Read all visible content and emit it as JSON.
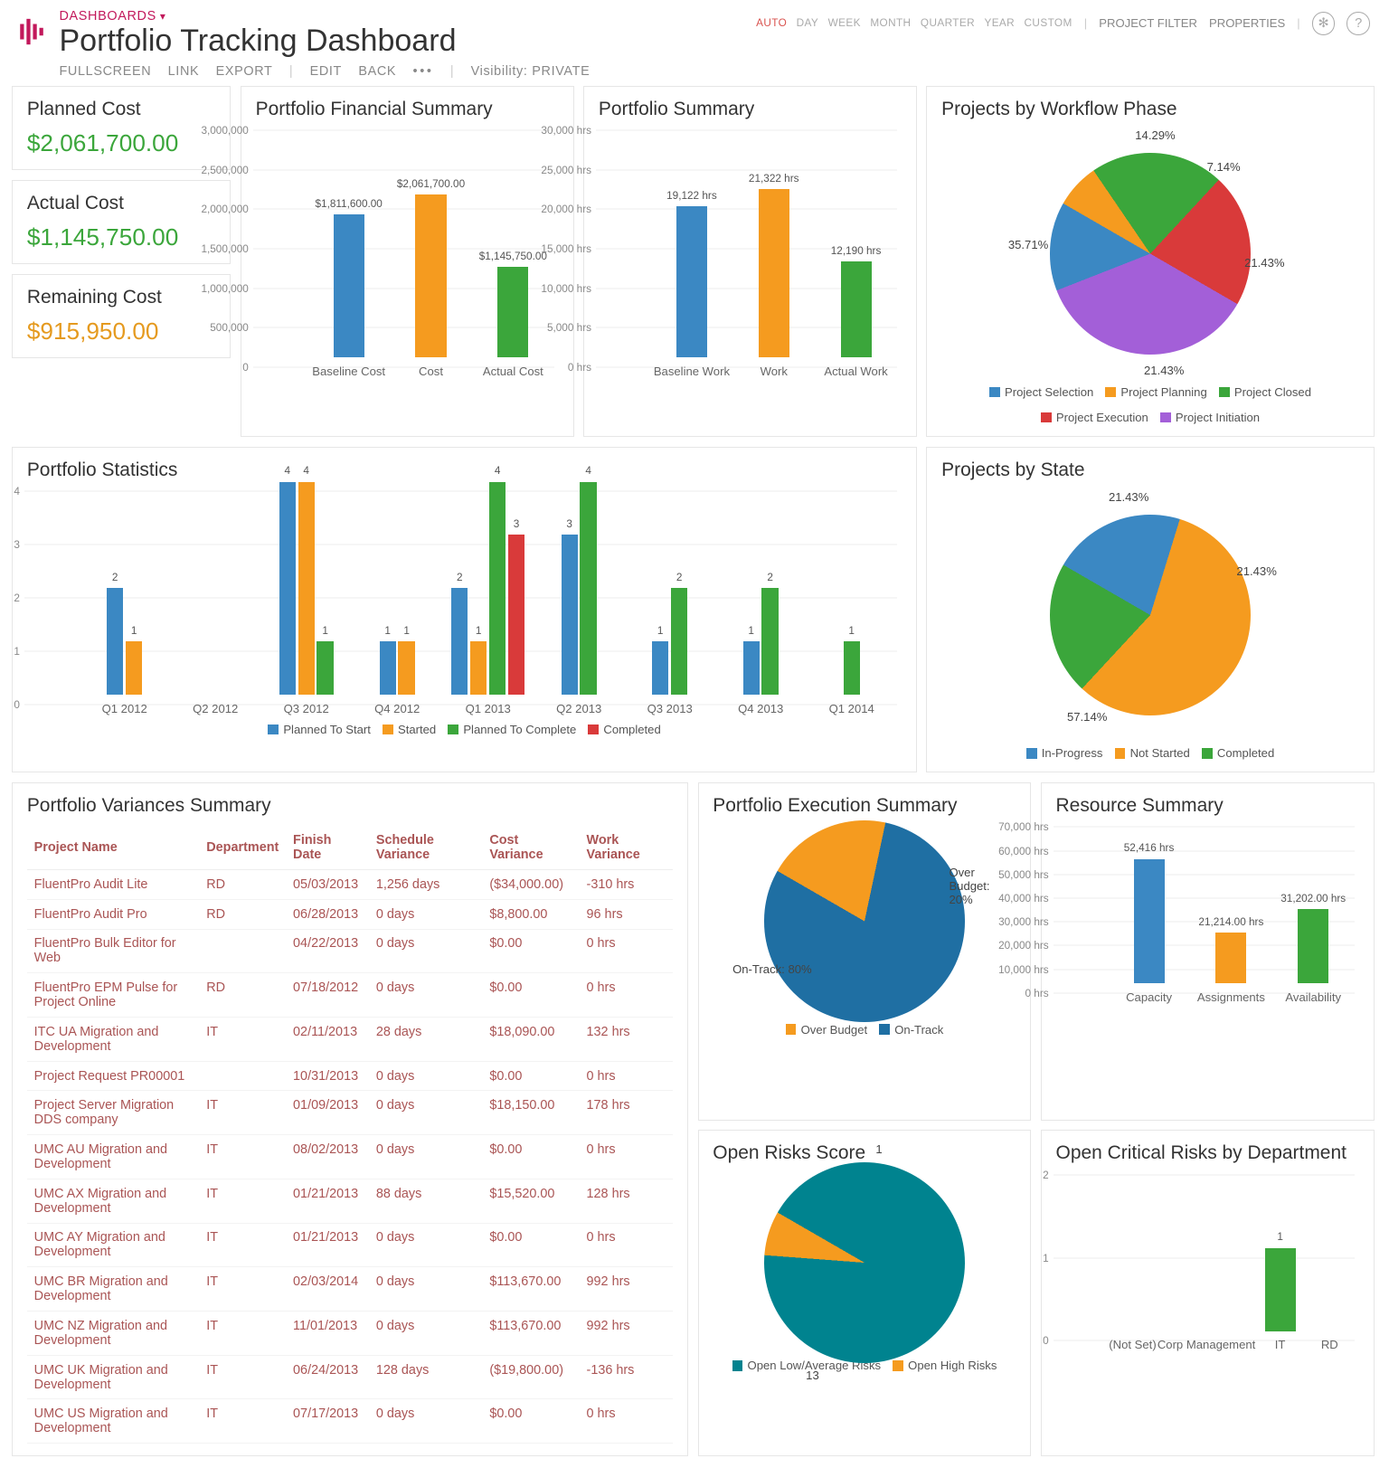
{
  "header": {
    "crumb": "DASHBOARDS",
    "title": "Portfolio Tracking Dashboard",
    "toolbar": {
      "fullscreen": "FULLSCREEN",
      "link": "LINK",
      "export": "EXPORT",
      "edit": "EDIT",
      "back": "BACK",
      "vis_label": "Visibility:",
      "vis_value": "PRIVATE"
    },
    "scope": [
      "AUTO",
      "DAY",
      "WEEK",
      "MONTH",
      "QUARTER",
      "YEAR",
      "CUSTOM"
    ],
    "scope_active": "AUTO",
    "filter": "PROJECT FILTER",
    "props": "PROPERTIES"
  },
  "kpi": {
    "planned": {
      "label": "Planned Cost",
      "value": "$2,061,700.00"
    },
    "actual": {
      "label": "Actual Cost",
      "value": "$1,145,750.00"
    },
    "remaining": {
      "label": "Remaining Cost",
      "value": "$915,950.00"
    }
  },
  "financial": {
    "title": "Portfolio Financial Summary",
    "type": "bar",
    "ylim": [
      0,
      3000000
    ],
    "ticks": [
      0,
      500000,
      1000000,
      1500000,
      2000000,
      2500000,
      3000000
    ],
    "tick_labels": [
      "0",
      "500,000",
      "1,000,000",
      "1,500,000",
      "2,000,000",
      "2,500,000",
      "3,000,000"
    ],
    "categories": [
      "Baseline Cost",
      "Cost",
      "Actual Cost"
    ],
    "values": [
      1811600,
      2061700,
      1145750
    ],
    "data_labels": [
      "$1,811,600.00",
      "$2,061,700.00",
      "$1,145,750.00"
    ],
    "colors": [
      "blue",
      "orange",
      "green"
    ]
  },
  "work": {
    "title": "Portfolio Summary",
    "type": "bar",
    "ylim": [
      0,
      30000
    ],
    "ticks": [
      0,
      5000,
      10000,
      15000,
      20000,
      25000,
      30000
    ],
    "tick_labels": [
      "0 hrs",
      "5,000 hrs",
      "10,000 hrs",
      "15,000 hrs",
      "20,000 hrs",
      "25,000 hrs",
      "30,000 hrs"
    ],
    "categories": [
      "Baseline Work",
      "Work",
      "Actual Work"
    ],
    "values": [
      19122,
      21322,
      12190
    ],
    "data_labels": [
      "19,122 hrs",
      "21,322 hrs",
      "12,190 hrs"
    ],
    "colors": [
      "blue",
      "orange",
      "green"
    ]
  },
  "phase": {
    "title": "Projects by Workflow Phase",
    "type": "pie",
    "legend": [
      "Project Selection",
      "Project Planning",
      "Project Closed",
      "Project Execution",
      "Project Initiation"
    ],
    "colors": [
      "blue",
      "orange",
      "green",
      "red",
      "purple"
    ],
    "slices": [
      {
        "label": "7.14%",
        "v": 7.14,
        "c": "orange"
      },
      {
        "label": "21.43%",
        "v": 21.43,
        "c": "green"
      },
      {
        "label": "21.43%",
        "v": 21.43,
        "c": "red"
      },
      {
        "label": "35.71%",
        "v": 35.71,
        "c": "purple"
      },
      {
        "label": "14.29%",
        "v": 14.29,
        "c": "blue"
      }
    ]
  },
  "stats": {
    "title": "Portfolio Statistics",
    "type": "bar",
    "ylim": [
      0,
      4
    ],
    "ticks": [
      0,
      1,
      2,
      3,
      4
    ],
    "categories": [
      "Q1 2012",
      "Q2 2012",
      "Q3 2012",
      "Q4 2012",
      "Q1 2013",
      "Q2 2013",
      "Q3 2013",
      "Q4 2013",
      "Q1 2014"
    ],
    "series_names": [
      "Planned To Start",
      "Started",
      "Planned To Complete",
      "Completed"
    ],
    "colors": [
      "blue",
      "orange",
      "green",
      "red"
    ],
    "data": [
      {
        "cat": "Q1 2012",
        "v": [
          2,
          1,
          0,
          0
        ]
      },
      {
        "cat": "Q2 2012",
        "v": [
          0,
          0,
          0,
          0
        ]
      },
      {
        "cat": "Q3 2012",
        "v": [
          4,
          4,
          1,
          0
        ]
      },
      {
        "cat": "Q4 2012",
        "v": [
          1,
          1,
          0,
          0
        ]
      },
      {
        "cat": "Q1 2013",
        "v": [
          2,
          1,
          4,
          3
        ]
      },
      {
        "cat": "Q2 2013",
        "v": [
          3,
          0,
          4,
          0
        ]
      },
      {
        "cat": "Q3 2013",
        "v": [
          1,
          0,
          2,
          0
        ]
      },
      {
        "cat": "Q4 2013",
        "v": [
          1,
          0,
          2,
          0
        ]
      },
      {
        "cat": "Q1 2014",
        "v": [
          0,
          0,
          1,
          0
        ]
      }
    ]
  },
  "state": {
    "title": "Projects by State",
    "type": "pie",
    "legend": [
      "In-Progress",
      "Not Started",
      "Completed"
    ],
    "colors": [
      "blue",
      "orange",
      "green"
    ],
    "slices": [
      {
        "label": "21.43%",
        "v": 21.43,
        "c": "blue"
      },
      {
        "label": "57.14%",
        "v": 57.14,
        "c": "orange"
      },
      {
        "label": "21.43%",
        "v": 21.43,
        "c": "green"
      }
    ]
  },
  "variances": {
    "title": "Portfolio Variances Summary",
    "type": "table",
    "columns": [
      "Project Name",
      "Department",
      "Finish Date",
      "Schedule Variance",
      "Cost Variance",
      "Work Variance"
    ],
    "rows": [
      [
        "FluentPro Audit Lite",
        "RD",
        "05/03/2013",
        "1,256 days",
        "($34,000.00)",
        "-310 hrs"
      ],
      [
        "FluentPro Audit Pro",
        "RD",
        "06/28/2013",
        "0 days",
        "$8,800.00",
        "96 hrs"
      ],
      [
        "FluentPro Bulk Editor for Web",
        "",
        "04/22/2013",
        "0 days",
        "$0.00",
        "0 hrs"
      ],
      [
        "FluentPro EPM Pulse for Project Online",
        "RD",
        "07/18/2012",
        "0 days",
        "$0.00",
        "0 hrs"
      ],
      [
        "ITC UA Migration and Development",
        "IT",
        "02/11/2013",
        "28 days",
        "$18,090.00",
        "132 hrs"
      ],
      [
        "Project Request PR00001",
        "",
        "10/31/2013",
        "0 days",
        "$0.00",
        "0 hrs"
      ],
      [
        "Project Server Migration DDS company",
        "IT",
        "01/09/2013",
        "0 days",
        "$18,150.00",
        "178 hrs"
      ],
      [
        "UMC AU Migration and Development",
        "IT",
        "08/02/2013",
        "0 days",
        "$0.00",
        "0 hrs"
      ],
      [
        "UMC AX Migration and Development",
        "IT",
        "01/21/2013",
        "88 days",
        "$15,520.00",
        "128 hrs"
      ],
      [
        "UMC AY Migration and Development",
        "IT",
        "01/21/2013",
        "0 days",
        "$0.00",
        "0 hrs"
      ],
      [
        "UMC BR Migration and Development",
        "IT",
        "02/03/2014",
        "0 days",
        "$113,670.00",
        "992 hrs"
      ],
      [
        "UMC NZ Migration and Development",
        "IT",
        "11/01/2013",
        "0 days",
        "$113,670.00",
        "992 hrs"
      ],
      [
        "UMC UK Migration and Development",
        "IT",
        "06/24/2013",
        "128 days",
        "($19,800.00)",
        "-136 hrs"
      ],
      [
        "UMC US Migration and Development",
        "IT",
        "07/17/2013",
        "0 days",
        "$0.00",
        "0 hrs"
      ]
    ]
  },
  "exec": {
    "title": "Portfolio Execution Summary",
    "type": "pie",
    "legend": [
      "Over Budget",
      "On-Track"
    ],
    "colors": [
      "orange",
      "steel"
    ],
    "slices": [
      {
        "label": "Over Budget: 20%",
        "v": 20,
        "c": "orange"
      },
      {
        "label": "On-Track: 80%",
        "v": 80,
        "c": "steel"
      }
    ]
  },
  "resource": {
    "title": "Resource Summary",
    "type": "bar",
    "ylim": [
      0,
      70000
    ],
    "ticks": [
      0,
      10000,
      20000,
      30000,
      40000,
      50000,
      60000,
      70000
    ],
    "tick_labels": [
      "0 hrs",
      "10,000 hrs",
      "20,000 hrs",
      "30,000 hrs",
      "40,000 hrs",
      "50,000 hrs",
      "60,000 hrs",
      "70,000 hrs"
    ],
    "categories": [
      "Capacity",
      "Assignments",
      "Availability"
    ],
    "values": [
      52416,
      21214,
      31202
    ],
    "data_labels": [
      "52,416 hrs",
      "21,214.00 hrs",
      "31,202.00 hrs"
    ],
    "colors": [
      "blue",
      "orange",
      "green"
    ]
  },
  "risks": {
    "title": "Open Risks Score",
    "type": "pie",
    "legend": [
      "Open Low/Average Risks",
      "Open High Risks"
    ],
    "colors": [
      "teal",
      "orange"
    ],
    "slices": [
      {
        "label": "13",
        "v": 13,
        "c": "teal"
      },
      {
        "label": "1",
        "v": 1,
        "c": "orange"
      }
    ]
  },
  "crit": {
    "title": "Open Critical Risks by Department",
    "type": "bar",
    "ylim": [
      0,
      2
    ],
    "ticks": [
      0,
      1,
      2
    ],
    "categories": [
      "(Not Set)",
      "Corp Management",
      "IT",
      "RD"
    ],
    "values": [
      0,
      0,
      1,
      0
    ],
    "data_labels": [
      "",
      "",
      "1",
      ""
    ],
    "colors": [
      "green",
      "green",
      "green",
      "green"
    ]
  },
  "chart_data": [
    {
      "id": "financial",
      "type": "bar",
      "categories": [
        "Baseline Cost",
        "Cost",
        "Actual Cost"
      ],
      "values": [
        1811600,
        2061700,
        1145750
      ],
      "ylim": [
        0,
        3000000
      ],
      "title": "Portfolio Financial Summary"
    },
    {
      "id": "work",
      "type": "bar",
      "categories": [
        "Baseline Work",
        "Work",
        "Actual Work"
      ],
      "values": [
        19122,
        21322,
        12190
      ],
      "ylim": [
        0,
        30000
      ],
      "title": "Portfolio Summary",
      "unit": "hrs"
    },
    {
      "id": "phase",
      "type": "pie",
      "title": "Projects by Workflow Phase",
      "series": [
        {
          "name": "Project Selection",
          "value": 14.29
        },
        {
          "name": "Project Planning",
          "value": 7.14
        },
        {
          "name": "Project Closed",
          "value": 21.43
        },
        {
          "name": "Project Execution",
          "value": 21.43
        },
        {
          "name": "Project Initiation",
          "value": 35.71
        }
      ]
    },
    {
      "id": "stats",
      "type": "bar",
      "title": "Portfolio Statistics",
      "categories": [
        "Q1 2012",
        "Q2 2012",
        "Q3 2012",
        "Q4 2012",
        "Q1 2013",
        "Q2 2013",
        "Q3 2013",
        "Q4 2013",
        "Q1 2014"
      ],
      "series": [
        {
          "name": "Planned To Start",
          "values": [
            2,
            0,
            4,
            1,
            2,
            3,
            1,
            1,
            0
          ]
        },
        {
          "name": "Started",
          "values": [
            1,
            0,
            4,
            1,
            1,
            0,
            0,
            0,
            0
          ]
        },
        {
          "name": "Planned To Complete",
          "values": [
            0,
            0,
            1,
            0,
            4,
            4,
            2,
            2,
            1
          ]
        },
        {
          "name": "Completed",
          "values": [
            0,
            0,
            0,
            0,
            3,
            0,
            0,
            0,
            0
          ]
        }
      ],
      "ylim": [
        0,
        4
      ]
    },
    {
      "id": "state",
      "type": "pie",
      "title": "Projects by State",
      "series": [
        {
          "name": "In-Progress",
          "value": 21.43
        },
        {
          "name": "Not Started",
          "value": 57.14
        },
        {
          "name": "Completed",
          "value": 21.43
        }
      ]
    },
    {
      "id": "exec",
      "type": "pie",
      "title": "Portfolio Execution Summary",
      "series": [
        {
          "name": "Over Budget",
          "value": 20
        },
        {
          "name": "On-Track",
          "value": 80
        }
      ]
    },
    {
      "id": "resource",
      "type": "bar",
      "title": "Resource Summary",
      "categories": [
        "Capacity",
        "Assignments",
        "Availability"
      ],
      "values": [
        52416,
        21214,
        31202
      ],
      "ylim": [
        0,
        70000
      ],
      "unit": "hrs"
    },
    {
      "id": "risks",
      "type": "pie",
      "title": "Open Risks Score",
      "series": [
        {
          "name": "Open Low/Average Risks",
          "value": 13
        },
        {
          "name": "Open High Risks",
          "value": 1
        }
      ]
    },
    {
      "id": "crit",
      "type": "bar",
      "title": "Open Critical Risks by Department",
      "categories": [
        "(Not Set)",
        "Corp Management",
        "IT",
        "RD"
      ],
      "values": [
        0,
        0,
        1,
        0
      ],
      "ylim": [
        0,
        2
      ]
    }
  ]
}
